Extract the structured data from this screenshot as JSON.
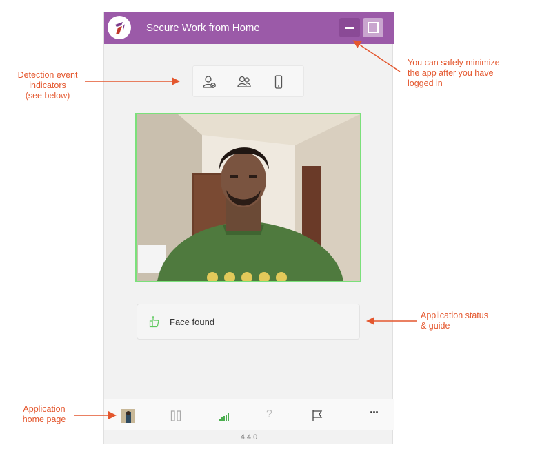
{
  "window": {
    "title": "Secure Work from Home",
    "minimize_icon": "minimize-icon",
    "maximize_icon": "maximize-icon"
  },
  "indicators": [
    {
      "icon": "person-check-icon"
    },
    {
      "icon": "multiple-people-icon"
    },
    {
      "icon": "mobile-phone-icon"
    }
  ],
  "camera": {
    "description_icon": "webcam-feed"
  },
  "status": {
    "text": "Face found",
    "icon": "thumbs-up-icon",
    "color": "#5cc85c"
  },
  "bottom_bar": [
    {
      "icon": "home-thumbnail-icon"
    },
    {
      "icon": "pause-icon"
    },
    {
      "icon": "signal-strength-icon"
    },
    {
      "icon": "help-icon",
      "label": "?"
    },
    {
      "icon": "flag-icon"
    },
    {
      "icon": "more-icon",
      "label": "···"
    }
  ],
  "version": "4.4.0",
  "annotations": {
    "detection": [
      "Detection event",
      "indicators",
      "(see below)"
    ],
    "minimize": [
      "You can safely minimize",
      "the app after you have",
      "logged in"
    ],
    "status": [
      "Application status",
      "& guide"
    ],
    "home": [
      "Application",
      "home page"
    ]
  },
  "colors": {
    "accent": "#9b5aa8",
    "annotation": "#e4572e",
    "frame": "#7be07b"
  }
}
